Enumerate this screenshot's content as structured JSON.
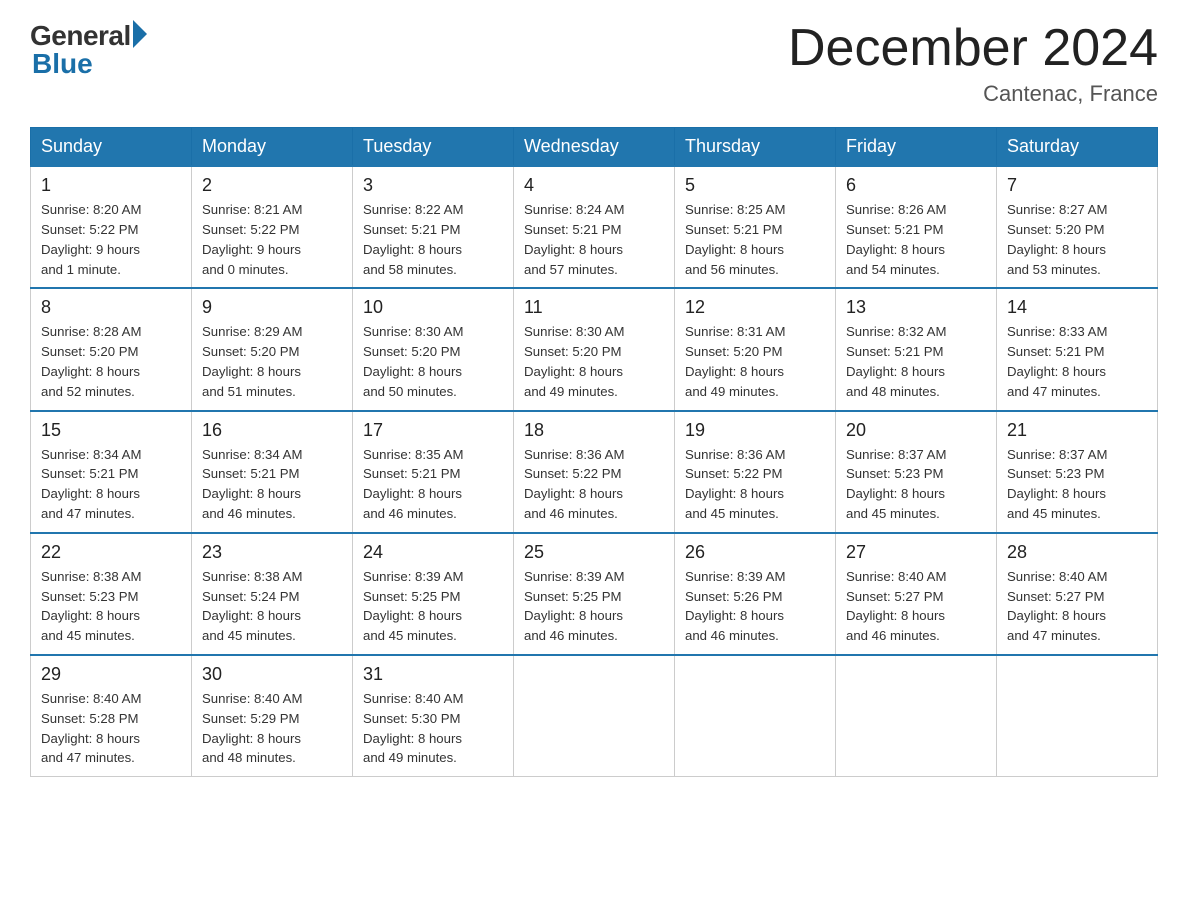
{
  "header": {
    "logo_general": "General",
    "logo_blue": "Blue",
    "title": "December 2024",
    "location": "Cantenac, France"
  },
  "weekdays": [
    "Sunday",
    "Monday",
    "Tuesday",
    "Wednesday",
    "Thursday",
    "Friday",
    "Saturday"
  ],
  "weeks": [
    [
      {
        "day": "1",
        "info": "Sunrise: 8:20 AM\nSunset: 5:22 PM\nDaylight: 9 hours\nand 1 minute."
      },
      {
        "day": "2",
        "info": "Sunrise: 8:21 AM\nSunset: 5:22 PM\nDaylight: 9 hours\nand 0 minutes."
      },
      {
        "day": "3",
        "info": "Sunrise: 8:22 AM\nSunset: 5:21 PM\nDaylight: 8 hours\nand 58 minutes."
      },
      {
        "day": "4",
        "info": "Sunrise: 8:24 AM\nSunset: 5:21 PM\nDaylight: 8 hours\nand 57 minutes."
      },
      {
        "day": "5",
        "info": "Sunrise: 8:25 AM\nSunset: 5:21 PM\nDaylight: 8 hours\nand 56 minutes."
      },
      {
        "day": "6",
        "info": "Sunrise: 8:26 AM\nSunset: 5:21 PM\nDaylight: 8 hours\nand 54 minutes."
      },
      {
        "day": "7",
        "info": "Sunrise: 8:27 AM\nSunset: 5:20 PM\nDaylight: 8 hours\nand 53 minutes."
      }
    ],
    [
      {
        "day": "8",
        "info": "Sunrise: 8:28 AM\nSunset: 5:20 PM\nDaylight: 8 hours\nand 52 minutes."
      },
      {
        "day": "9",
        "info": "Sunrise: 8:29 AM\nSunset: 5:20 PM\nDaylight: 8 hours\nand 51 minutes."
      },
      {
        "day": "10",
        "info": "Sunrise: 8:30 AM\nSunset: 5:20 PM\nDaylight: 8 hours\nand 50 minutes."
      },
      {
        "day": "11",
        "info": "Sunrise: 8:30 AM\nSunset: 5:20 PM\nDaylight: 8 hours\nand 49 minutes."
      },
      {
        "day": "12",
        "info": "Sunrise: 8:31 AM\nSunset: 5:20 PM\nDaylight: 8 hours\nand 49 minutes."
      },
      {
        "day": "13",
        "info": "Sunrise: 8:32 AM\nSunset: 5:21 PM\nDaylight: 8 hours\nand 48 minutes."
      },
      {
        "day": "14",
        "info": "Sunrise: 8:33 AM\nSunset: 5:21 PM\nDaylight: 8 hours\nand 47 minutes."
      }
    ],
    [
      {
        "day": "15",
        "info": "Sunrise: 8:34 AM\nSunset: 5:21 PM\nDaylight: 8 hours\nand 47 minutes."
      },
      {
        "day": "16",
        "info": "Sunrise: 8:34 AM\nSunset: 5:21 PM\nDaylight: 8 hours\nand 46 minutes."
      },
      {
        "day": "17",
        "info": "Sunrise: 8:35 AM\nSunset: 5:21 PM\nDaylight: 8 hours\nand 46 minutes."
      },
      {
        "day": "18",
        "info": "Sunrise: 8:36 AM\nSunset: 5:22 PM\nDaylight: 8 hours\nand 46 minutes."
      },
      {
        "day": "19",
        "info": "Sunrise: 8:36 AM\nSunset: 5:22 PM\nDaylight: 8 hours\nand 45 minutes."
      },
      {
        "day": "20",
        "info": "Sunrise: 8:37 AM\nSunset: 5:23 PM\nDaylight: 8 hours\nand 45 minutes."
      },
      {
        "day": "21",
        "info": "Sunrise: 8:37 AM\nSunset: 5:23 PM\nDaylight: 8 hours\nand 45 minutes."
      }
    ],
    [
      {
        "day": "22",
        "info": "Sunrise: 8:38 AM\nSunset: 5:23 PM\nDaylight: 8 hours\nand 45 minutes."
      },
      {
        "day": "23",
        "info": "Sunrise: 8:38 AM\nSunset: 5:24 PM\nDaylight: 8 hours\nand 45 minutes."
      },
      {
        "day": "24",
        "info": "Sunrise: 8:39 AM\nSunset: 5:25 PM\nDaylight: 8 hours\nand 45 minutes."
      },
      {
        "day": "25",
        "info": "Sunrise: 8:39 AM\nSunset: 5:25 PM\nDaylight: 8 hours\nand 46 minutes."
      },
      {
        "day": "26",
        "info": "Sunrise: 8:39 AM\nSunset: 5:26 PM\nDaylight: 8 hours\nand 46 minutes."
      },
      {
        "day": "27",
        "info": "Sunrise: 8:40 AM\nSunset: 5:27 PM\nDaylight: 8 hours\nand 46 minutes."
      },
      {
        "day": "28",
        "info": "Sunrise: 8:40 AM\nSunset: 5:27 PM\nDaylight: 8 hours\nand 47 minutes."
      }
    ],
    [
      {
        "day": "29",
        "info": "Sunrise: 8:40 AM\nSunset: 5:28 PM\nDaylight: 8 hours\nand 47 minutes."
      },
      {
        "day": "30",
        "info": "Sunrise: 8:40 AM\nSunset: 5:29 PM\nDaylight: 8 hours\nand 48 minutes."
      },
      {
        "day": "31",
        "info": "Sunrise: 8:40 AM\nSunset: 5:30 PM\nDaylight: 8 hours\nand 49 minutes."
      },
      null,
      null,
      null,
      null
    ]
  ]
}
